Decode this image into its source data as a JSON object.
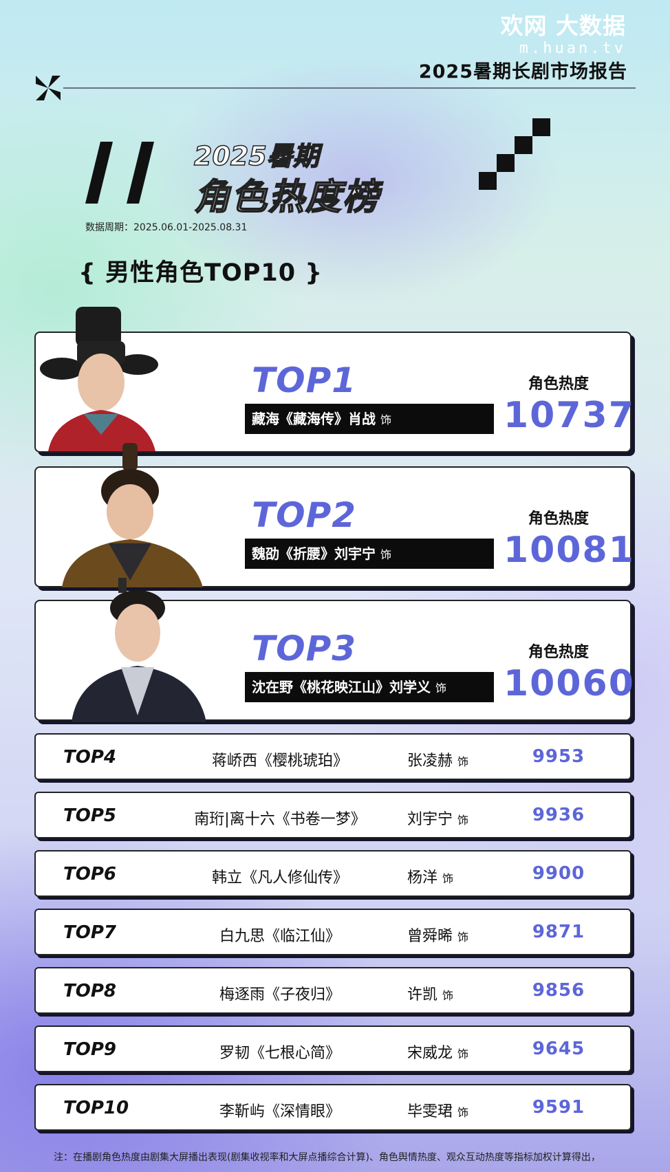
{
  "header": {
    "brand_logo": "欢网 大数据",
    "brand_url": "m.huan.tv",
    "report_title": "2025暑期长剧市场报告",
    "period_title": "2025暑期",
    "ranking_title": "角色热度榜",
    "data_period": "数据周期：2025.06.01-2025.08.31",
    "section_title": "{ 男性角色TOP10 }"
  },
  "colors": {
    "accent": "#5d66d8",
    "ink": "#111111",
    "card": "#ffffff"
  },
  "top3": [
    {
      "rank": "TOP1",
      "role": "藏海《藏海传》肖战",
      "act": "饰",
      "heat_label": "角色热度",
      "heat": "10737"
    },
    {
      "rank": "TOP2",
      "role": "魏劭《折腰》刘宇宁",
      "act": "饰",
      "heat_label": "角色热度",
      "heat": "10081"
    },
    {
      "rank": "TOP3",
      "role": "沈在野《桃花映江山》刘学义",
      "act": "饰",
      "heat_label": "角色热度",
      "heat": "10060"
    }
  ],
  "rows": [
    {
      "rank": "TOP4",
      "role": "蒋峤西《樱桃琥珀》",
      "actor": "张凌赫",
      "act": "饰",
      "heat": "9953"
    },
    {
      "rank": "TOP5",
      "role": "南珩|离十六《书卷一梦》",
      "actor": "刘宇宁",
      "act": "饰",
      "heat": "9936"
    },
    {
      "rank": "TOP6",
      "role": "韩立《凡人修仙传》",
      "actor": "杨洋",
      "act": "饰",
      "heat": "9900"
    },
    {
      "rank": "TOP7",
      "role": "白九思《临江仙》",
      "actor": "曾舜晞",
      "act": "饰",
      "heat": "9871"
    },
    {
      "rank": "TOP8",
      "role": "梅逐雨《子夜归》",
      "actor": "许凯",
      "act": "饰",
      "heat": "9856"
    },
    {
      "rank": "TOP9",
      "role": "罗韧《七根心简》",
      "actor": "宋威龙",
      "act": "饰",
      "heat": "9645"
    },
    {
      "rank": "TOP10",
      "role": "李靳屿《深情眼》",
      "actor": "毕雯珺",
      "act": "饰",
      "heat": "9591"
    }
  ],
  "footnote": "注：在播剧角色热度由剧集大屏播出表现(剧集收视率和大屏点播综合计算)、角色舆情热度、观众互动热度等指标加权计算得出，"
}
